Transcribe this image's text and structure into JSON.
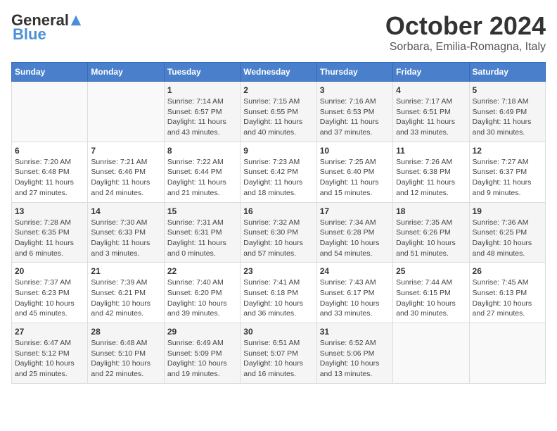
{
  "header": {
    "logo_general": "General",
    "logo_blue": "Blue",
    "month_title": "October 2024",
    "location": "Sorbara, Emilia-Romagna, Italy"
  },
  "weekdays": [
    "Sunday",
    "Monday",
    "Tuesday",
    "Wednesday",
    "Thursday",
    "Friday",
    "Saturday"
  ],
  "weeks": [
    [
      {
        "day": "",
        "info": ""
      },
      {
        "day": "",
        "info": ""
      },
      {
        "day": "1",
        "info": "Sunrise: 7:14 AM\nSunset: 6:57 PM\nDaylight: 11 hours and 43 minutes."
      },
      {
        "day": "2",
        "info": "Sunrise: 7:15 AM\nSunset: 6:55 PM\nDaylight: 11 hours and 40 minutes."
      },
      {
        "day": "3",
        "info": "Sunrise: 7:16 AM\nSunset: 6:53 PM\nDaylight: 11 hours and 37 minutes."
      },
      {
        "day": "4",
        "info": "Sunrise: 7:17 AM\nSunset: 6:51 PM\nDaylight: 11 hours and 33 minutes."
      },
      {
        "day": "5",
        "info": "Sunrise: 7:18 AM\nSunset: 6:49 PM\nDaylight: 11 hours and 30 minutes."
      }
    ],
    [
      {
        "day": "6",
        "info": "Sunrise: 7:20 AM\nSunset: 6:48 PM\nDaylight: 11 hours and 27 minutes."
      },
      {
        "day": "7",
        "info": "Sunrise: 7:21 AM\nSunset: 6:46 PM\nDaylight: 11 hours and 24 minutes."
      },
      {
        "day": "8",
        "info": "Sunrise: 7:22 AM\nSunset: 6:44 PM\nDaylight: 11 hours and 21 minutes."
      },
      {
        "day": "9",
        "info": "Sunrise: 7:23 AM\nSunset: 6:42 PM\nDaylight: 11 hours and 18 minutes."
      },
      {
        "day": "10",
        "info": "Sunrise: 7:25 AM\nSunset: 6:40 PM\nDaylight: 11 hours and 15 minutes."
      },
      {
        "day": "11",
        "info": "Sunrise: 7:26 AM\nSunset: 6:38 PM\nDaylight: 11 hours and 12 minutes."
      },
      {
        "day": "12",
        "info": "Sunrise: 7:27 AM\nSunset: 6:37 PM\nDaylight: 11 hours and 9 minutes."
      }
    ],
    [
      {
        "day": "13",
        "info": "Sunrise: 7:28 AM\nSunset: 6:35 PM\nDaylight: 11 hours and 6 minutes."
      },
      {
        "day": "14",
        "info": "Sunrise: 7:30 AM\nSunset: 6:33 PM\nDaylight: 11 hours and 3 minutes."
      },
      {
        "day": "15",
        "info": "Sunrise: 7:31 AM\nSunset: 6:31 PM\nDaylight: 11 hours and 0 minutes."
      },
      {
        "day": "16",
        "info": "Sunrise: 7:32 AM\nSunset: 6:30 PM\nDaylight: 10 hours and 57 minutes."
      },
      {
        "day": "17",
        "info": "Sunrise: 7:34 AM\nSunset: 6:28 PM\nDaylight: 10 hours and 54 minutes."
      },
      {
        "day": "18",
        "info": "Sunrise: 7:35 AM\nSunset: 6:26 PM\nDaylight: 10 hours and 51 minutes."
      },
      {
        "day": "19",
        "info": "Sunrise: 7:36 AM\nSunset: 6:25 PM\nDaylight: 10 hours and 48 minutes."
      }
    ],
    [
      {
        "day": "20",
        "info": "Sunrise: 7:37 AM\nSunset: 6:23 PM\nDaylight: 10 hours and 45 minutes."
      },
      {
        "day": "21",
        "info": "Sunrise: 7:39 AM\nSunset: 6:21 PM\nDaylight: 10 hours and 42 minutes."
      },
      {
        "day": "22",
        "info": "Sunrise: 7:40 AM\nSunset: 6:20 PM\nDaylight: 10 hours and 39 minutes."
      },
      {
        "day": "23",
        "info": "Sunrise: 7:41 AM\nSunset: 6:18 PM\nDaylight: 10 hours and 36 minutes."
      },
      {
        "day": "24",
        "info": "Sunrise: 7:43 AM\nSunset: 6:17 PM\nDaylight: 10 hours and 33 minutes."
      },
      {
        "day": "25",
        "info": "Sunrise: 7:44 AM\nSunset: 6:15 PM\nDaylight: 10 hours and 30 minutes."
      },
      {
        "day": "26",
        "info": "Sunrise: 7:45 AM\nSunset: 6:13 PM\nDaylight: 10 hours and 27 minutes."
      }
    ],
    [
      {
        "day": "27",
        "info": "Sunrise: 6:47 AM\nSunset: 5:12 PM\nDaylight: 10 hours and 25 minutes."
      },
      {
        "day": "28",
        "info": "Sunrise: 6:48 AM\nSunset: 5:10 PM\nDaylight: 10 hours and 22 minutes."
      },
      {
        "day": "29",
        "info": "Sunrise: 6:49 AM\nSunset: 5:09 PM\nDaylight: 10 hours and 19 minutes."
      },
      {
        "day": "30",
        "info": "Sunrise: 6:51 AM\nSunset: 5:07 PM\nDaylight: 10 hours and 16 minutes."
      },
      {
        "day": "31",
        "info": "Sunrise: 6:52 AM\nSunset: 5:06 PM\nDaylight: 10 hours and 13 minutes."
      },
      {
        "day": "",
        "info": ""
      },
      {
        "day": "",
        "info": ""
      }
    ]
  ]
}
